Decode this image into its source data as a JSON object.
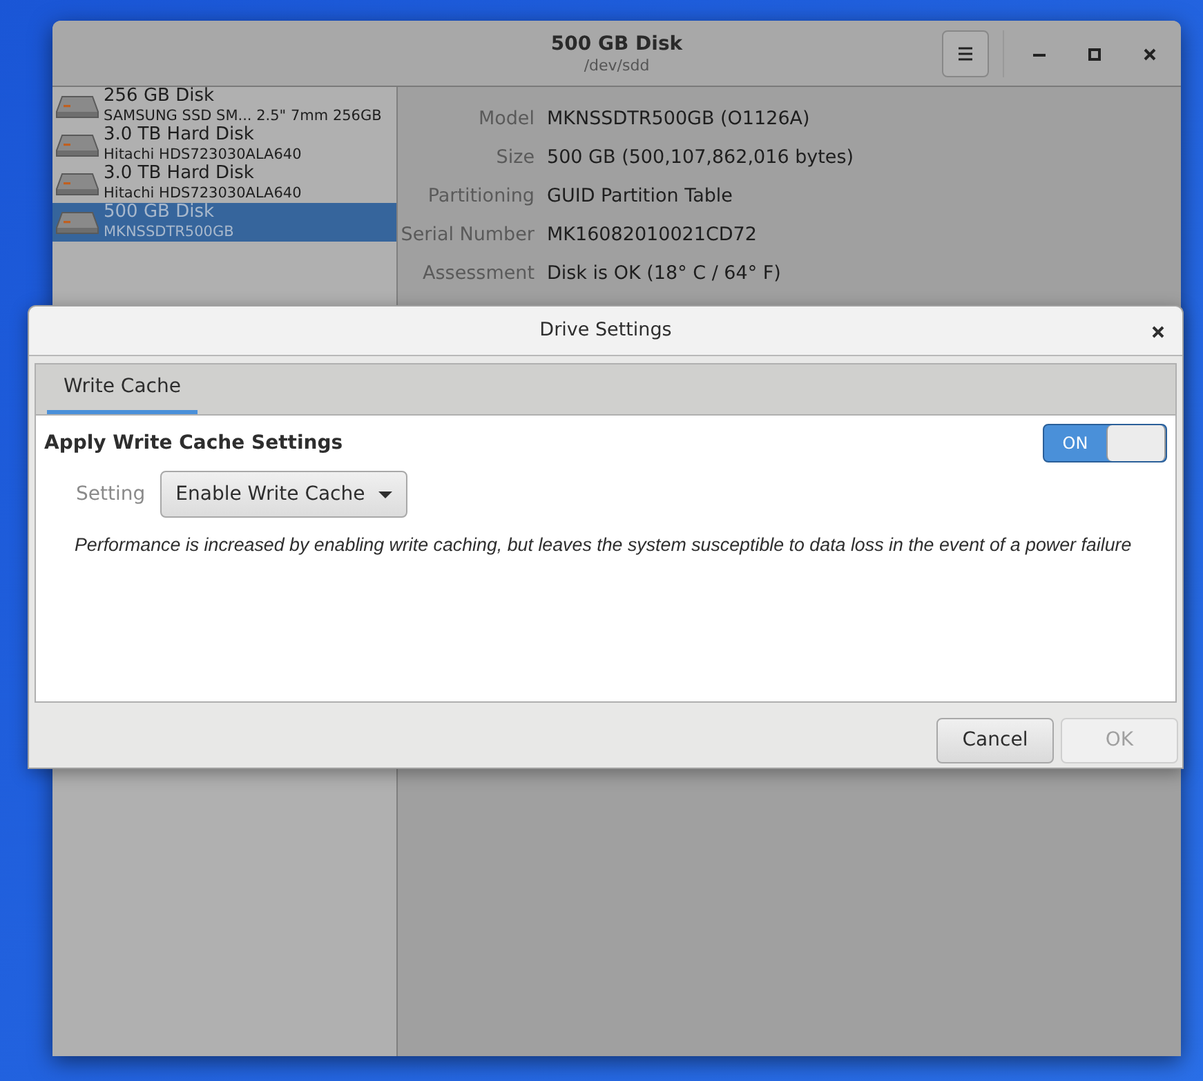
{
  "window": {
    "title": "500 GB Disk",
    "subtitle": "/dev/sdd"
  },
  "drives": [
    {
      "name": "256 GB Disk",
      "detail": "SAMSUNG SSD SM... 2.5\" 7mm 256GB",
      "selected": false
    },
    {
      "name": "3.0 TB Hard Disk",
      "detail": "Hitachi HDS723030ALA640",
      "selected": false
    },
    {
      "name": "3.0 TB Hard Disk",
      "detail": "Hitachi HDS723030ALA640",
      "selected": false
    },
    {
      "name": "500 GB Disk",
      "detail": "MKNSSDTR500GB",
      "selected": true
    }
  ],
  "properties": [
    {
      "label": "Model",
      "value": "MKNSSDTR500GB (O1126A)"
    },
    {
      "label": "Size",
      "value": "500 GB (500,107,862,016 bytes)"
    },
    {
      "label": "Partitioning",
      "value": "GUID Partition Table"
    },
    {
      "label": "Serial Number",
      "value": "MK16082010021CD72"
    },
    {
      "label": "Assessment",
      "value": "Disk is OK (18° C / 64° F)"
    }
  ],
  "dialog": {
    "title": "Drive Settings",
    "tabs": [
      {
        "label": "Write Cache",
        "selected": true
      }
    ],
    "heading": "Apply Write Cache Settings",
    "switch": {
      "label": "ON",
      "on": true
    },
    "setting_label": "Setting",
    "setting_value": "Enable Write Cache",
    "description": "Performance is increased by enabling write caching, but leaves the system susceptible to data loss in the event of a power failure",
    "buttons": [
      {
        "label": "Cancel",
        "disabled": false
      },
      {
        "label": "OK",
        "disabled": true
      }
    ]
  }
}
